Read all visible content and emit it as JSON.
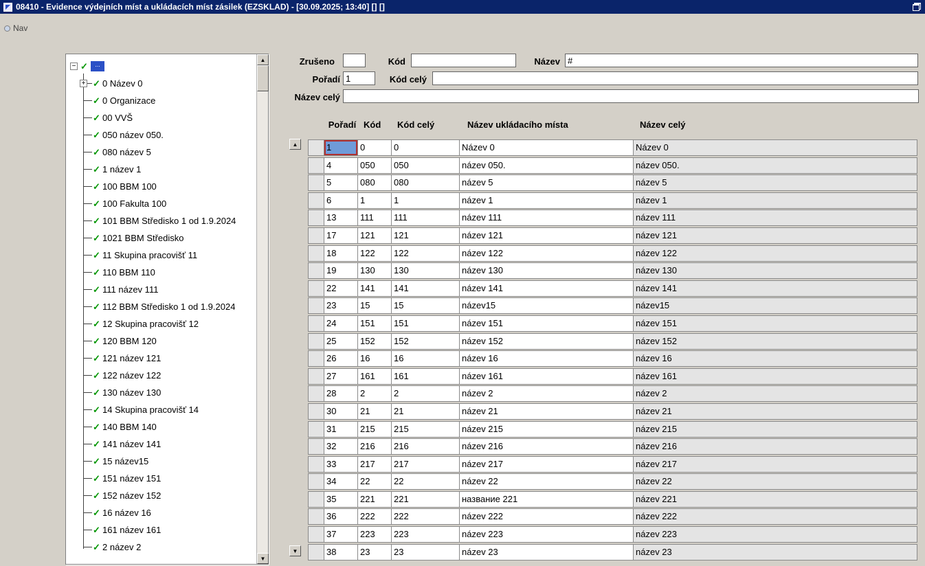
{
  "colors": {
    "titlebar_bg": "#0a246a",
    "window_bg": "#d4d0c8",
    "selection_blue": "#6f9bd9",
    "selection_border_red": "#b03030",
    "tree_selected_blue": "#2b50c6",
    "check_green": "#009600",
    "readonly_cell_bg": "#e4e4e4"
  },
  "icons": {
    "checkmark": "✓",
    "expand_plus": "+",
    "collapse_minus": "−",
    "scroll_up": "▲",
    "scroll_down": "▼"
  },
  "titlebar": {
    "title": "08410 - Evidence výdejních míst a ukládacích míst zásilek (EZSKLAD) - [30.09.2025; 13:40]  []  []"
  },
  "nav": {
    "label": "Nav"
  },
  "tree": {
    "root_label": "...",
    "items": [
      {
        "label": "0 Název 0",
        "expander": "plus"
      },
      {
        "label": "0 Organizace"
      },
      {
        "label": "00 VVŠ"
      },
      {
        "label": "050 název 050."
      },
      {
        "label": "080 název 5"
      },
      {
        "label": "1 název 1"
      },
      {
        "label": "100 BBM 100"
      },
      {
        "label": "100 Fakulta 100"
      },
      {
        "label": "101 BBM Středisko 1 od 1.9.2024"
      },
      {
        "label": "1021 BBM Středisko"
      },
      {
        "label": "11 Skupina pracovišť 11"
      },
      {
        "label": "110 BBM 110"
      },
      {
        "label": "111 název 111"
      },
      {
        "label": "112 BBM Středisko 1 od 1.9.2024"
      },
      {
        "label": "12 Skupina pracovišť 12"
      },
      {
        "label": "120 BBM 120"
      },
      {
        "label": "121 název 121"
      },
      {
        "label": "122 název 122"
      },
      {
        "label": "130 název 130"
      },
      {
        "label": "14 Skupina pracovišť 14"
      },
      {
        "label": "140 BBM 140"
      },
      {
        "label": "141 název 141"
      },
      {
        "label": "15 název15"
      },
      {
        "label": "151 název 151"
      },
      {
        "label": "152 název 152"
      },
      {
        "label": "16 název 16"
      },
      {
        "label": "161 název 161"
      },
      {
        "label": "2 název 2"
      }
    ]
  },
  "form": {
    "zruseno": {
      "label": "Zrušeno",
      "value": ""
    },
    "kod": {
      "label": "Kód",
      "value": ""
    },
    "nazev": {
      "label": "Název",
      "value": "#"
    },
    "poradi": {
      "label": "Pořadí",
      "value": "1"
    },
    "kod_cely": {
      "label": "Kód celý",
      "value": ""
    },
    "nazev_cely": {
      "label": "Název celý",
      "value": ""
    }
  },
  "table": {
    "headers": [
      "Pořadí",
      "Kód",
      "Kód celý",
      "Název ukládacího místa",
      "Název celý"
    ],
    "selected_cell": {
      "row": 0,
      "col": 0
    },
    "rows": [
      [
        "1",
        "0",
        "0",
        "Název 0",
        "Název 0"
      ],
      [
        "4",
        "050",
        "050",
        "název 050.",
        "název 050."
      ],
      [
        "5",
        "080",
        "080",
        "název 5",
        "název 5"
      ],
      [
        "6",
        "1",
        "1",
        "název 1",
        "název 1"
      ],
      [
        "13",
        "111",
        "111",
        "název 111",
        "název 111"
      ],
      [
        "17",
        "121",
        "121",
        "název 121",
        "název 121"
      ],
      [
        "18",
        "122",
        "122",
        "název 122",
        "název 122"
      ],
      [
        "19",
        "130",
        "130",
        "název 130",
        "název 130"
      ],
      [
        "22",
        "141",
        "141",
        "název 141",
        "název 141"
      ],
      [
        "23",
        "15",
        "15",
        "název15",
        "název15"
      ],
      [
        "24",
        "151",
        "151",
        "název 151",
        "název 151"
      ],
      [
        "25",
        "152",
        "152",
        "název 152",
        "název 152"
      ],
      [
        "26",
        "16",
        "16",
        "název 16",
        "název 16"
      ],
      [
        "27",
        "161",
        "161",
        "název 161",
        "název 161"
      ],
      [
        "28",
        "2",
        "2",
        "název 2",
        "název 2"
      ],
      [
        "30",
        "21",
        "21",
        "název 21",
        "název 21"
      ],
      [
        "31",
        "215",
        "215",
        "název 215",
        "název 215"
      ],
      [
        "32",
        "216",
        "216",
        "název 216",
        "název 216"
      ],
      [
        "33",
        "217",
        "217",
        "název 217",
        "název 217"
      ],
      [
        "34",
        "22",
        "22",
        "název 22",
        "název 22"
      ],
      [
        "35",
        "221",
        "221",
        "название 221",
        "název 221"
      ],
      [
        "36",
        "222",
        "222",
        "název 222",
        "název 222"
      ],
      [
        "37",
        "223",
        "223",
        "název 223",
        "název 223"
      ],
      [
        "38",
        "23",
        "23",
        "název 23",
        "název 23"
      ]
    ]
  }
}
